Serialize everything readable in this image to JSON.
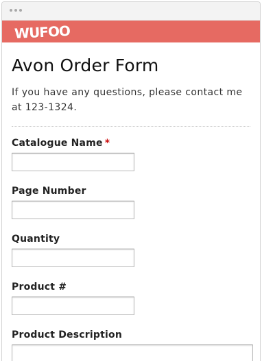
{
  "brand": {
    "logo_text": "WUFOO",
    "bar_color": "#e66a62"
  },
  "form": {
    "title": "Avon Order Form",
    "description": "If you have any questions, please contact me at 123-1324.",
    "fields": [
      {
        "label": "Catalogue Name",
        "required_mark": "*",
        "value": "",
        "placeholder": ""
      },
      {
        "label": "Page Number",
        "value": "",
        "placeholder": ""
      },
      {
        "label": "Quantity",
        "value": "",
        "placeholder": ""
      },
      {
        "label": "Product #",
        "value": "",
        "placeholder": ""
      },
      {
        "label": "Product Description",
        "value": "",
        "placeholder": ""
      }
    ]
  }
}
